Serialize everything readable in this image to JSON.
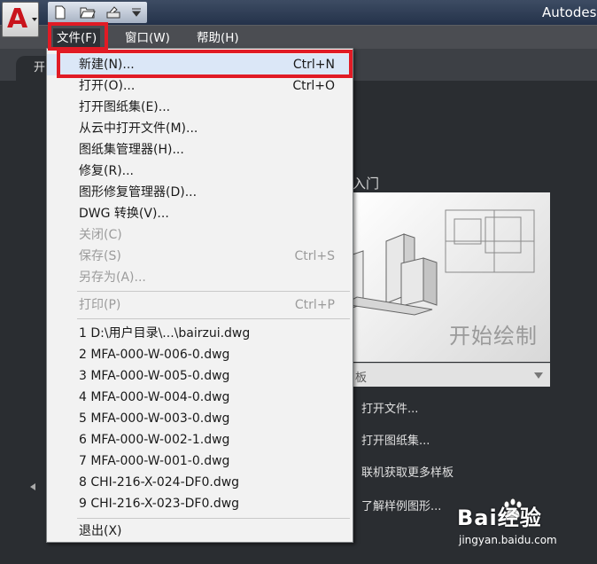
{
  "window": {
    "title": "Autodes"
  },
  "quick_access": {
    "icons": [
      "new-icon",
      "open-icon",
      "plot-icon",
      "customize-dropdown-icon"
    ]
  },
  "menubar": [
    {
      "label": "文件(F)",
      "active": true
    },
    {
      "label": "窗口(W)"
    },
    {
      "label": "帮助(H)"
    }
  ],
  "tabs": {
    "start": "开"
  },
  "start_page": {
    "section_title": "入门",
    "preview_caption": "开始绘制",
    "template_label": "板",
    "links": [
      "打开文件...",
      "打开图纸集...",
      "联机获取更多样板",
      "了解样例图形..."
    ]
  },
  "file_menu": {
    "group1": [
      {
        "label": "新建(N)...",
        "shortcut": "Ctrl+N",
        "highlighted": true
      },
      {
        "label": "打开(O)...",
        "shortcut": "Ctrl+O"
      },
      {
        "label": "打开图纸集(E)..."
      },
      {
        "label": "从云中打开文件(M)..."
      },
      {
        "label": "图纸集管理器(H)..."
      },
      {
        "label": "修复(R)..."
      },
      {
        "label": "图形修复管理器(D)..."
      },
      {
        "label": "DWG 转换(V)..."
      },
      {
        "label": "关闭(C)",
        "disabled": true
      },
      {
        "label": "保存(S)",
        "shortcut": "Ctrl+S",
        "disabled": true
      },
      {
        "label": "另存为(A)...",
        "disabled": true
      }
    ],
    "group2": [
      {
        "label": "打印(P)",
        "shortcut": "Ctrl+P",
        "disabled": true
      }
    ],
    "recent": [
      "1 D:\\用户目录\\...\\bairzui.dwg",
      "2 MFA-000-W-006-0.dwg",
      "3 MFA-000-W-005-0.dwg",
      "4 MFA-000-W-004-0.dwg",
      "5 MFA-000-W-003-0.dwg",
      "6 MFA-000-W-002-1.dwg",
      "7 MFA-000-W-001-0.dwg",
      "8 CHI-216-X-024-DF0.dwg",
      "9 CHI-216-X-023-DF0.dwg"
    ],
    "exit": {
      "label": "退出(X)"
    }
  },
  "watermark": {
    "text": "Bai经验",
    "url": "jingyan.baidu.com"
  },
  "colors": {
    "highlight_box": "#e11b25",
    "menu_bg": "#f2f2f2",
    "app_bg": "#2a2d31"
  }
}
